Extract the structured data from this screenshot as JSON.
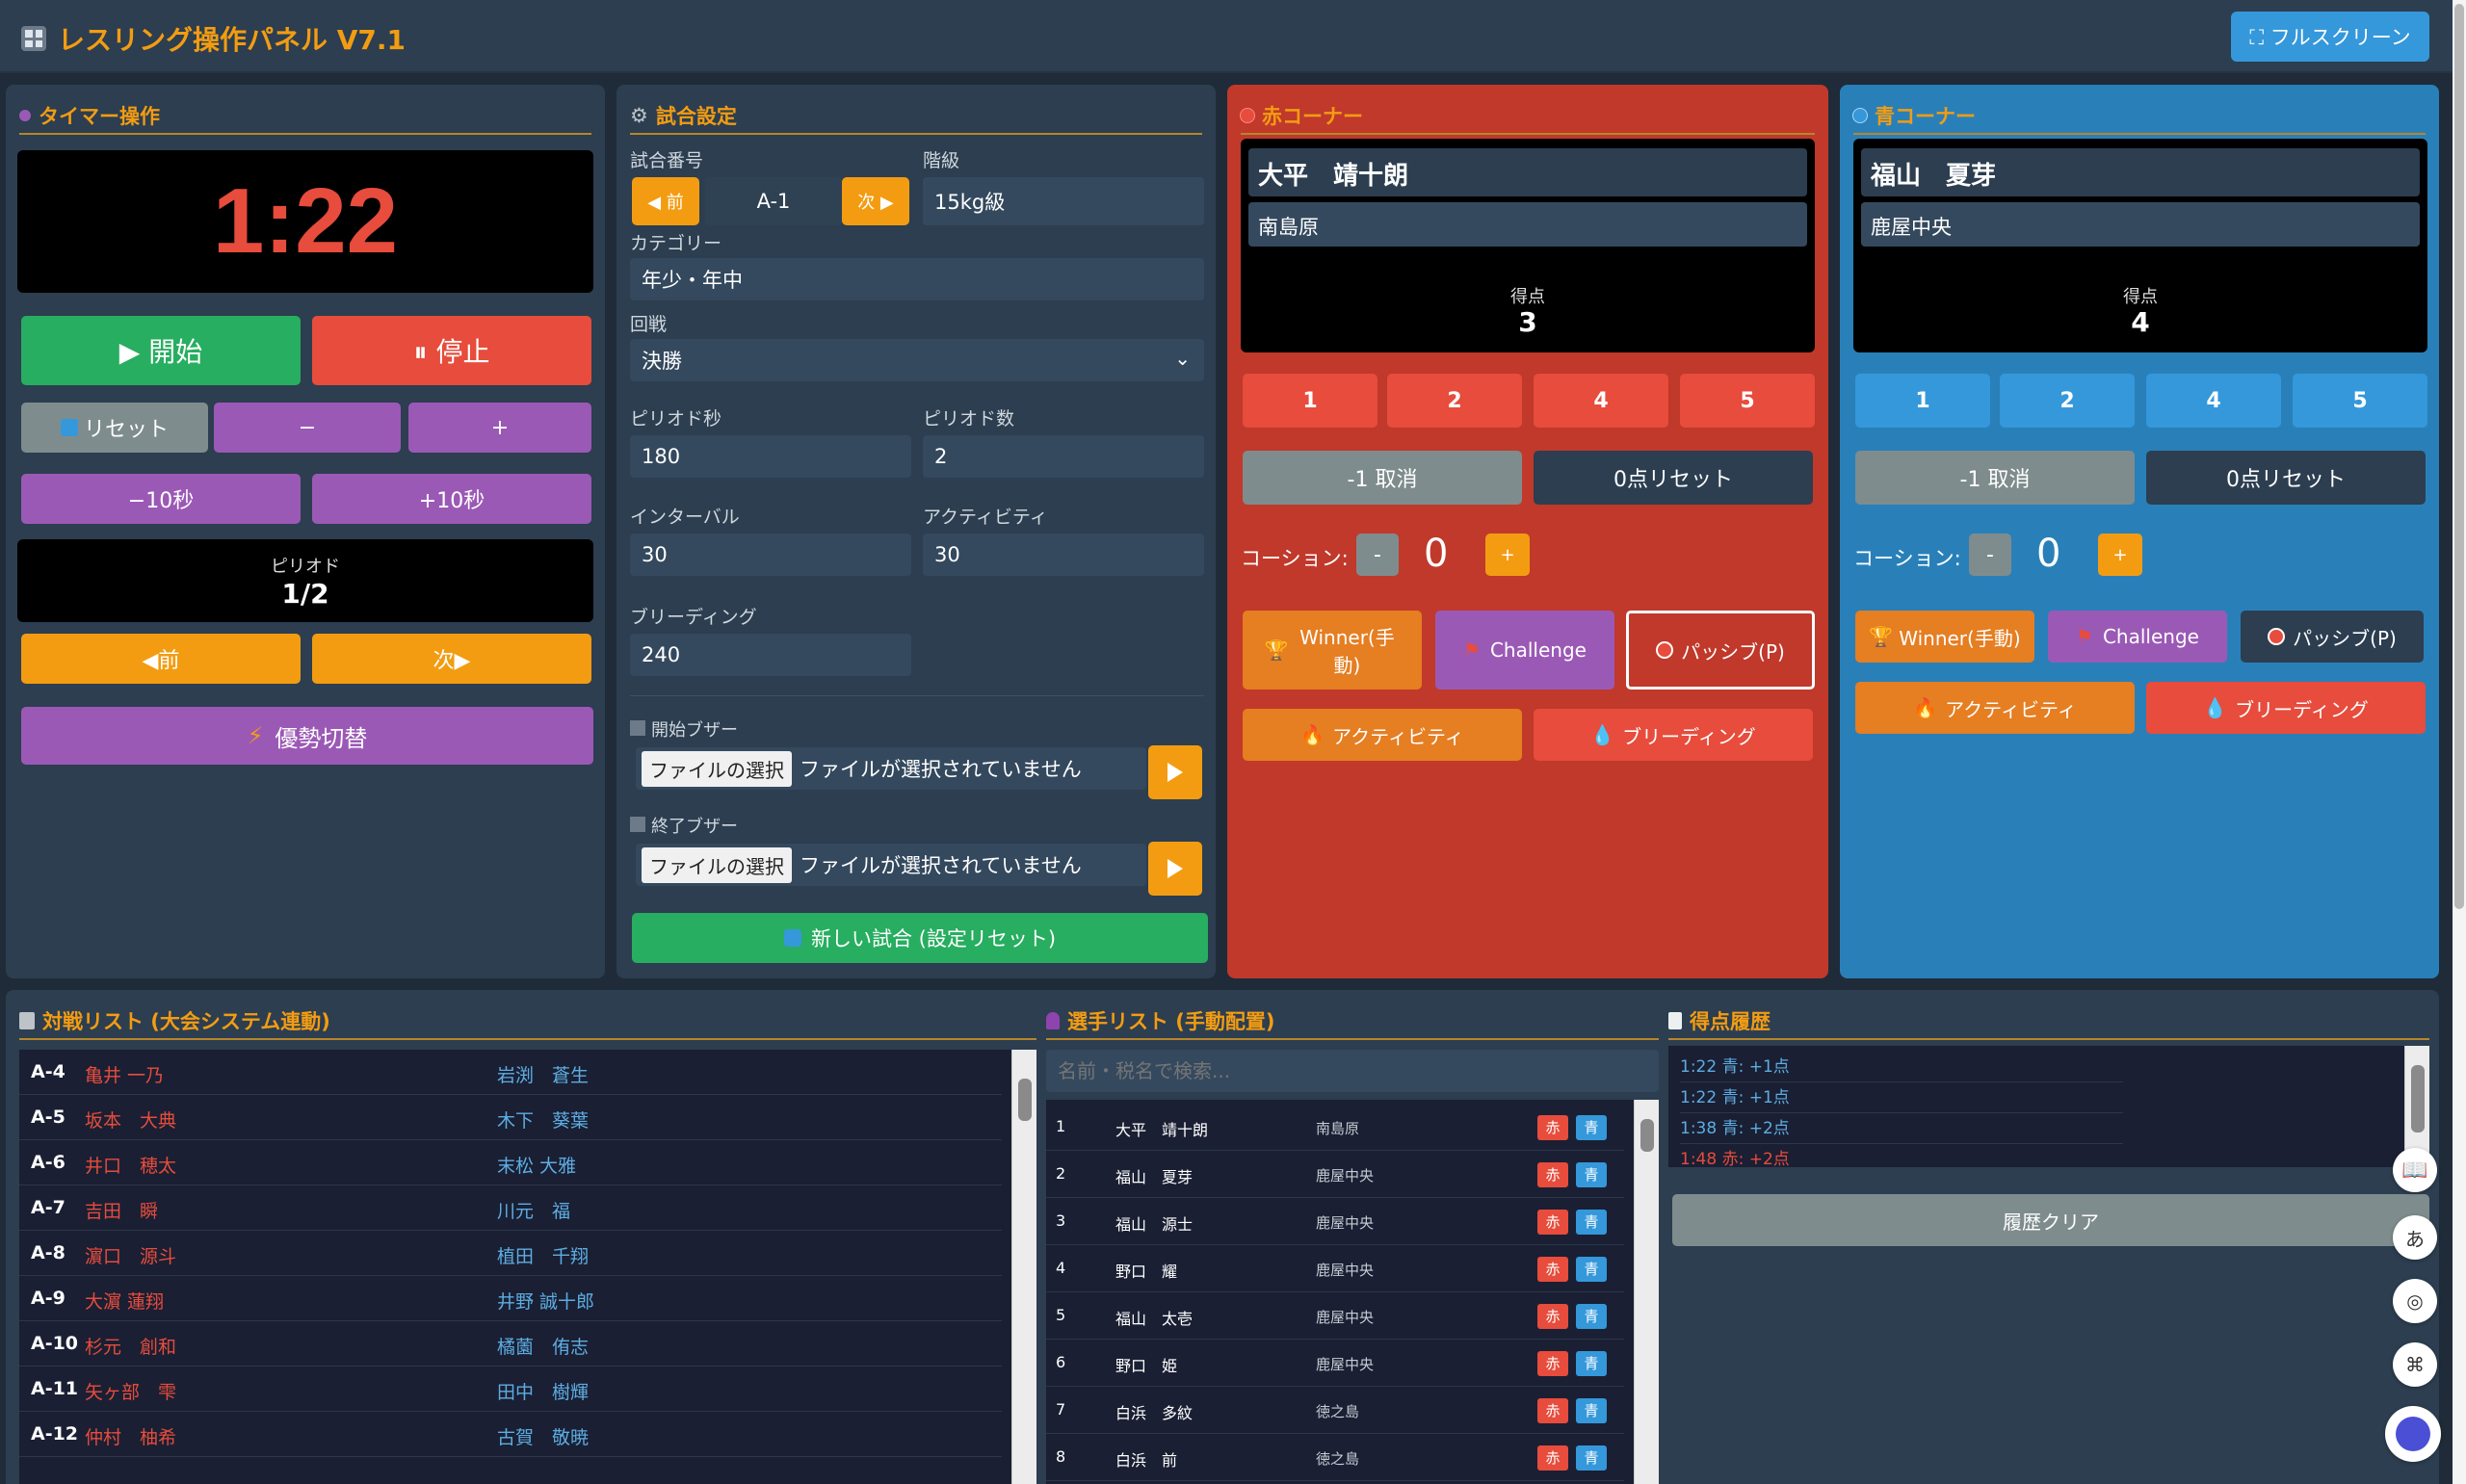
{
  "header": {
    "title": "レスリング操作パネル V7.1",
    "fullscreen_label": "⛶ フルスクリーン"
  },
  "timer": {
    "title": "タイマー操作",
    "time": "1:22",
    "start_label": "▶ 開始",
    "stop_label": "⏸ 停止",
    "reset_label": "リセット",
    "minus_label": "−",
    "plus_label": "+",
    "minus10_label": "−10秒",
    "plus10_label": "+10秒",
    "period_caption": "ピリオド",
    "period_value": "1/2",
    "prev_label": "◀前",
    "next_label": "次▶",
    "advantage_label": "優勢切替"
  },
  "settings": {
    "title": "試合設定",
    "match_no_label": "試合番号",
    "prev_label": "◀ 前",
    "match_no": "A-1",
    "next_label": "次 ▶",
    "class_label": "階級",
    "class_value": "15kg級",
    "category_label": "カテゴリー",
    "category_value": "年少・年中",
    "round_label": "回戦",
    "round_value": "決勝",
    "period_sec_label": "ピリオド秒",
    "period_sec_value": "180",
    "period_count_label": "ピリオド数",
    "period_count_value": "2",
    "interval_label": "インターバル",
    "interval_value": "30",
    "activity_label": "アクティビティ",
    "activity_value": "30",
    "bleeding_label": "ブリーディング",
    "bleeding_value": "240",
    "start_buzzer_label": "開始ブザー",
    "end_buzzer_label": "終了ブザー",
    "file_button": "ファイルの選択",
    "no_file": "ファイルが選択されていません",
    "new_match_label": "新しい試合 (設定リセット)"
  },
  "red": {
    "title": "赤コーナー",
    "name": "大平　靖十朗",
    "team": "南島原",
    "score_caption": "得点",
    "score": "3",
    "points": [
      "1",
      "2",
      "4",
      "5"
    ],
    "cancel_label": "-1 取消",
    "reset_label": "0点リセット",
    "caution_label": "コーション:",
    "caution_minus": "-",
    "caution_value": "0",
    "caution_plus": "+",
    "winner_label": "Winner(手動)",
    "challenge_label": "Challenge",
    "passive_label": "パッシブ(P)",
    "activity_label": "アクティビティ",
    "bleeding_label": "ブリーディング"
  },
  "blue": {
    "title": "青コーナー",
    "name": "福山　夏芽",
    "team": "鹿屋中央",
    "score_caption": "得点",
    "score": "4",
    "points": [
      "1",
      "2",
      "4",
      "5"
    ],
    "cancel_label": "-1 取消",
    "reset_label": "0点リセット",
    "caution_label": "コーション:",
    "caution_minus": "-",
    "caution_value": "0",
    "caution_plus": "+",
    "winner_label": "Winner(手動)",
    "challenge_label": "Challenge",
    "passive_label": "パッシブ(P)",
    "activity_label": "アクティビティ",
    "bleeding_label": "ブリーディング"
  },
  "bouts": {
    "title": "対戦リスト (大会システム連動)",
    "rows": [
      {
        "id": "A-4",
        "red": "亀井 一乃",
        "blue": "岩渕　蒼生"
      },
      {
        "id": "A-5",
        "red": "坂本　大典",
        "blue": "木下　葵葉"
      },
      {
        "id": "A-6",
        "red": "井口　穂太",
        "blue": "末松 大雅"
      },
      {
        "id": "A-7",
        "red": "吉田　瞬",
        "blue": "川元　福"
      },
      {
        "id": "A-8",
        "red": "濵口　源斗",
        "blue": "植田　千翔"
      },
      {
        "id": "A-9",
        "red": "大濵 蓮翔",
        "blue": "井野 誠十郎"
      },
      {
        "id": "A-10",
        "red": "杉元　創和",
        "blue": "橘薗　侑志"
      },
      {
        "id": "A-11",
        "red": "矢ヶ部　雫",
        "blue": "田中　樹輝"
      },
      {
        "id": "A-12",
        "red": "仲村　柚希",
        "blue": "古賀　敬暁"
      }
    ]
  },
  "players": {
    "title": "選手リスト (手動配置)",
    "search_placeholder": "名前・税名で検索...",
    "red_tag": "赤",
    "blue_tag": "青",
    "rows": [
      {
        "no": "1",
        "name": "大平　靖十朗",
        "team": "南島原"
      },
      {
        "no": "2",
        "name": "福山　夏芽",
        "team": "鹿屋中央"
      },
      {
        "no": "3",
        "name": "福山　源士",
        "team": "鹿屋中央"
      },
      {
        "no": "4",
        "name": "野口　耀",
        "team": "鹿屋中央"
      },
      {
        "no": "5",
        "name": "福山　太壱",
        "team": "鹿屋中央"
      },
      {
        "no": "6",
        "name": "野口　姫",
        "team": "鹿屋中央"
      },
      {
        "no": "7",
        "name": "白浜　多紋",
        "team": "徳之島"
      },
      {
        "no": "8",
        "name": "白浜　前",
        "team": "徳之島"
      }
    ]
  },
  "history": {
    "title": "得点履歴",
    "entries": [
      {
        "text": "1:22 青: +1点",
        "color": "#5dade2"
      },
      {
        "text": "1:22 青: +1点",
        "color": "#5dade2"
      },
      {
        "text": "1:38 青: +2点",
        "color": "#5dade2"
      },
      {
        "text": "1:48 赤: +2点",
        "color": "#e74c3c"
      }
    ],
    "clear_label": "履歴クリア"
  },
  "colors": {
    "accent": "#f39c12",
    "red": "#e74c3c",
    "blue": "#3498db",
    "green": "#27ae60",
    "purple": "#9b59b6"
  }
}
